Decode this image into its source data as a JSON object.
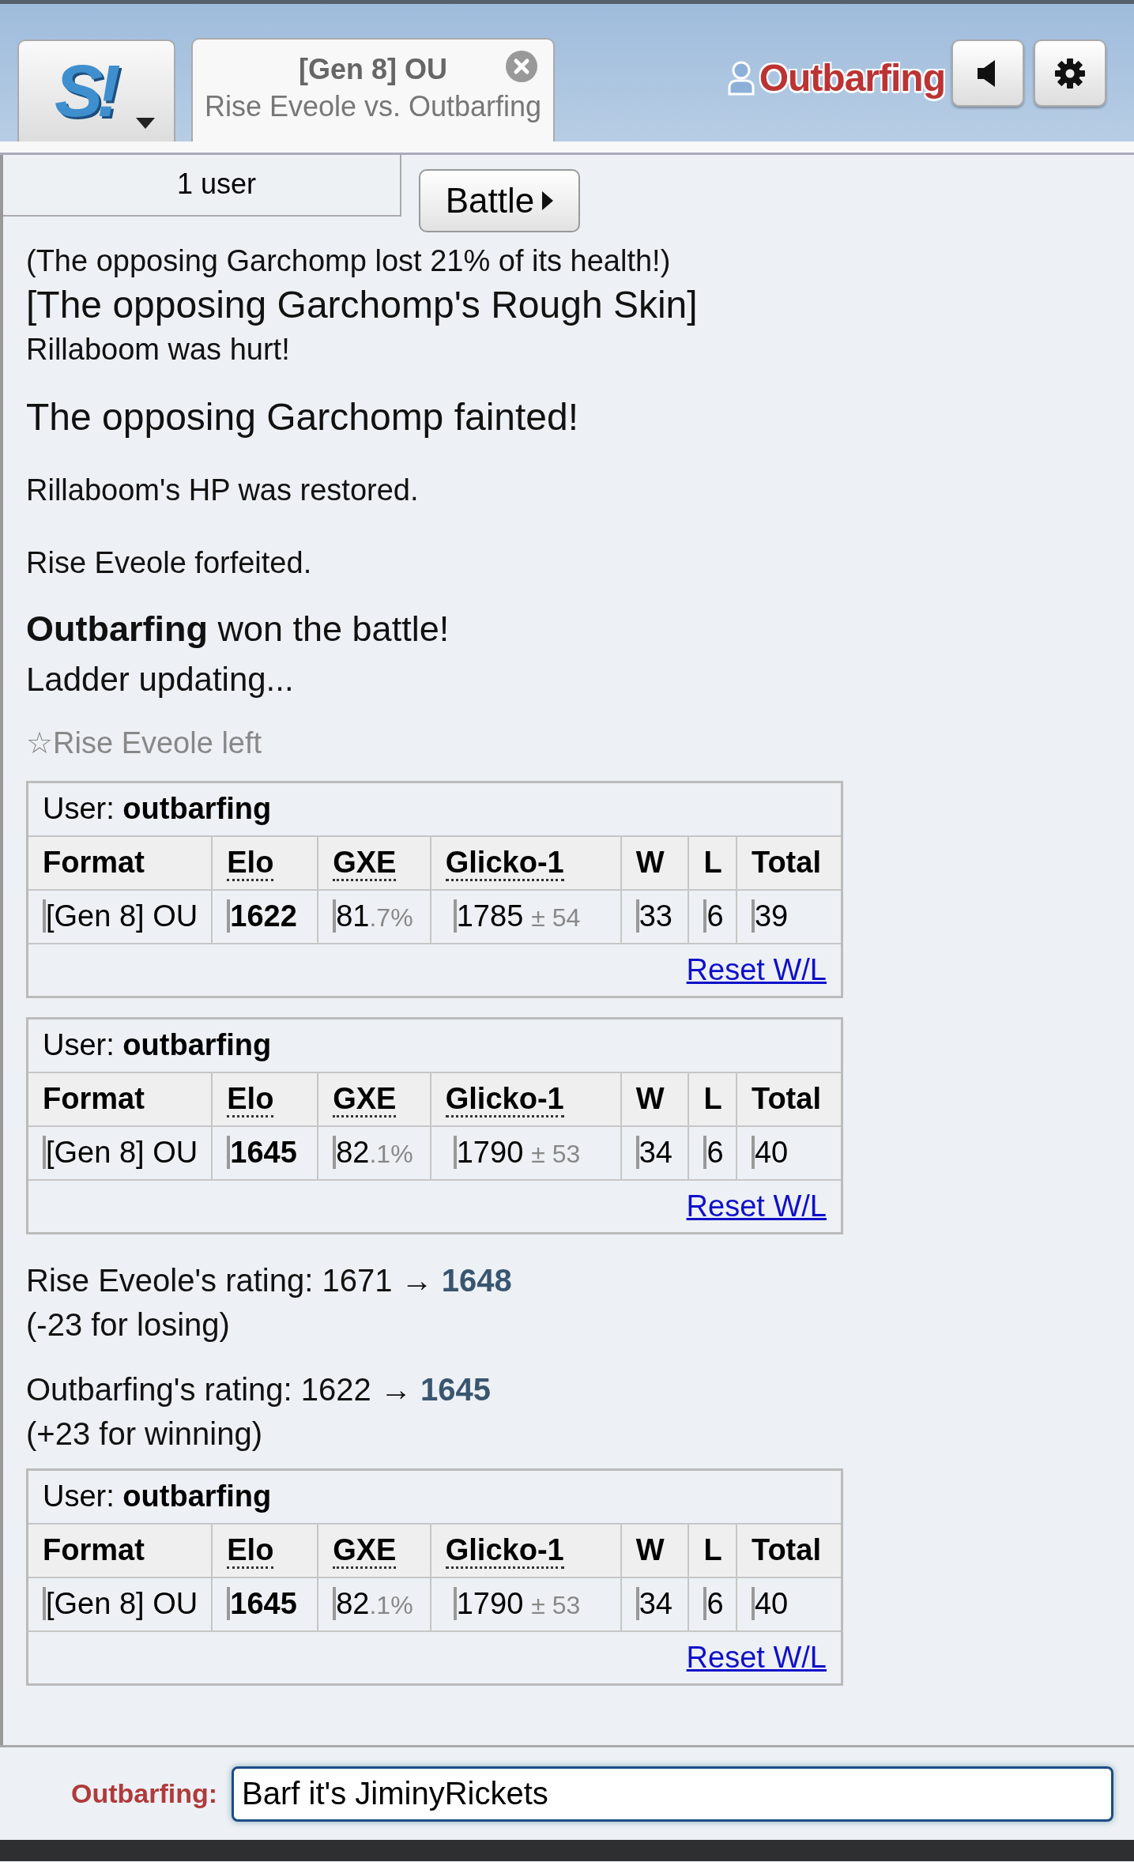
{
  "header": {
    "logo": "S!",
    "tabs": [
      {
        "format": "[Gen 8] OU",
        "players": "Rise Eveole vs. Outbarfing",
        "selected": true
      }
    ],
    "user": {
      "name": "Outbarfing"
    }
  },
  "users_popup": {
    "label": "1 user"
  },
  "battle_button": {
    "label": "Battle"
  },
  "log": [
    {
      "kind": "line",
      "text": "(The opposing Garchomp lost 21% of its health!)"
    },
    {
      "kind": "ability",
      "text": "[The opposing Garchomp's Rough Skin]"
    },
    {
      "kind": "line",
      "text": "Rillaboom was hurt!"
    },
    {
      "kind": "event",
      "text": "The opposing Garchomp fainted!"
    },
    {
      "kind": "note",
      "text": "Rillaboom's HP was restored."
    },
    {
      "kind": "note",
      "text": "Rise Eveole forfeited."
    },
    {
      "kind": "win",
      "text": "**Outbarfing** won the battle!"
    },
    {
      "kind": "ladder",
      "text": "Ladder updating..."
    },
    {
      "kind": "leave",
      "text": "☆Rise Eveole left"
    },
    {
      "kind": "table",
      "title": "User: **outbarfing**",
      "columns": [
        {
          "label": "Format",
          "abbr": false
        },
        {
          "label": "Elo",
          "abbr": true
        },
        {
          "label": "GXE",
          "abbr": true
        },
        {
          "label": "Glicko-1",
          "abbr": true
        },
        {
          "label": "W",
          "abbr": false
        },
        {
          "label": "L",
          "abbr": false
        },
        {
          "label": "Total",
          "abbr": false
        }
      ],
      "cells": [
        {
          "main": "[Gen 8] OU"
        },
        {
          "main": "1622"
        },
        {
          "main": "81",
          "minor": ".7%"
        },
        {
          "main": "1785",
          "minor": "± 54"
        },
        {
          "main": "33"
        },
        {
          "main": "6"
        },
        {
          "main": "39"
        }
      ],
      "link": "Reset W/L"
    },
    {
      "kind": "table",
      "title": "User: **outbarfing**",
      "columns": [
        {
          "label": "Format",
          "abbr": false
        },
        {
          "label": "Elo",
          "abbr": true
        },
        {
          "label": "GXE",
          "abbr": true
        },
        {
          "label": "Glicko-1",
          "abbr": true
        },
        {
          "label": "W",
          "abbr": false
        },
        {
          "label": "L",
          "abbr": false
        },
        {
          "label": "Total",
          "abbr": false
        }
      ],
      "cells": [
        {
          "main": "[Gen 8] OU"
        },
        {
          "main": "1645"
        },
        {
          "main": "82",
          "minor": ".1%"
        },
        {
          "main": "1790",
          "minor": "± 53"
        },
        {
          "main": "34"
        },
        {
          "main": "6"
        },
        {
          "main": "40"
        }
      ],
      "link": "Reset W/L"
    },
    {
      "kind": "rating",
      "text": "Rise Eveole's rating: 1671 → **1648**",
      "detail": "(-23 for losing)"
    },
    {
      "kind": "rating",
      "text": "Outbarfing's rating: 1622 → **1645**",
      "detail": "(+23 for winning)"
    },
    {
      "kind": "table",
      "title": "User: **outbarfing**",
      "columns": [
        {
          "label": "Format",
          "abbr": false
        },
        {
          "label": "Elo",
          "abbr": true
        },
        {
          "label": "GXE",
          "abbr": true
        },
        {
          "label": "Glicko-1",
          "abbr": true
        },
        {
          "label": "W",
          "abbr": false
        },
        {
          "label": "L",
          "abbr": false
        },
        {
          "label": "Total",
          "abbr": false
        }
      ],
      "cells": [
        {
          "main": "[Gen 8] OU"
        },
        {
          "main": "1645"
        },
        {
          "main": "82",
          "minor": ".1%"
        },
        {
          "main": "1790",
          "minor": "± 53"
        },
        {
          "main": "34"
        },
        {
          "main": "6"
        },
        {
          "main": "40"
        }
      ],
      "link": "Reset W/L"
    }
  ],
  "chat": {
    "label": "Outbarfing:",
    "value": "Barf it's JiminyRickets"
  }
}
